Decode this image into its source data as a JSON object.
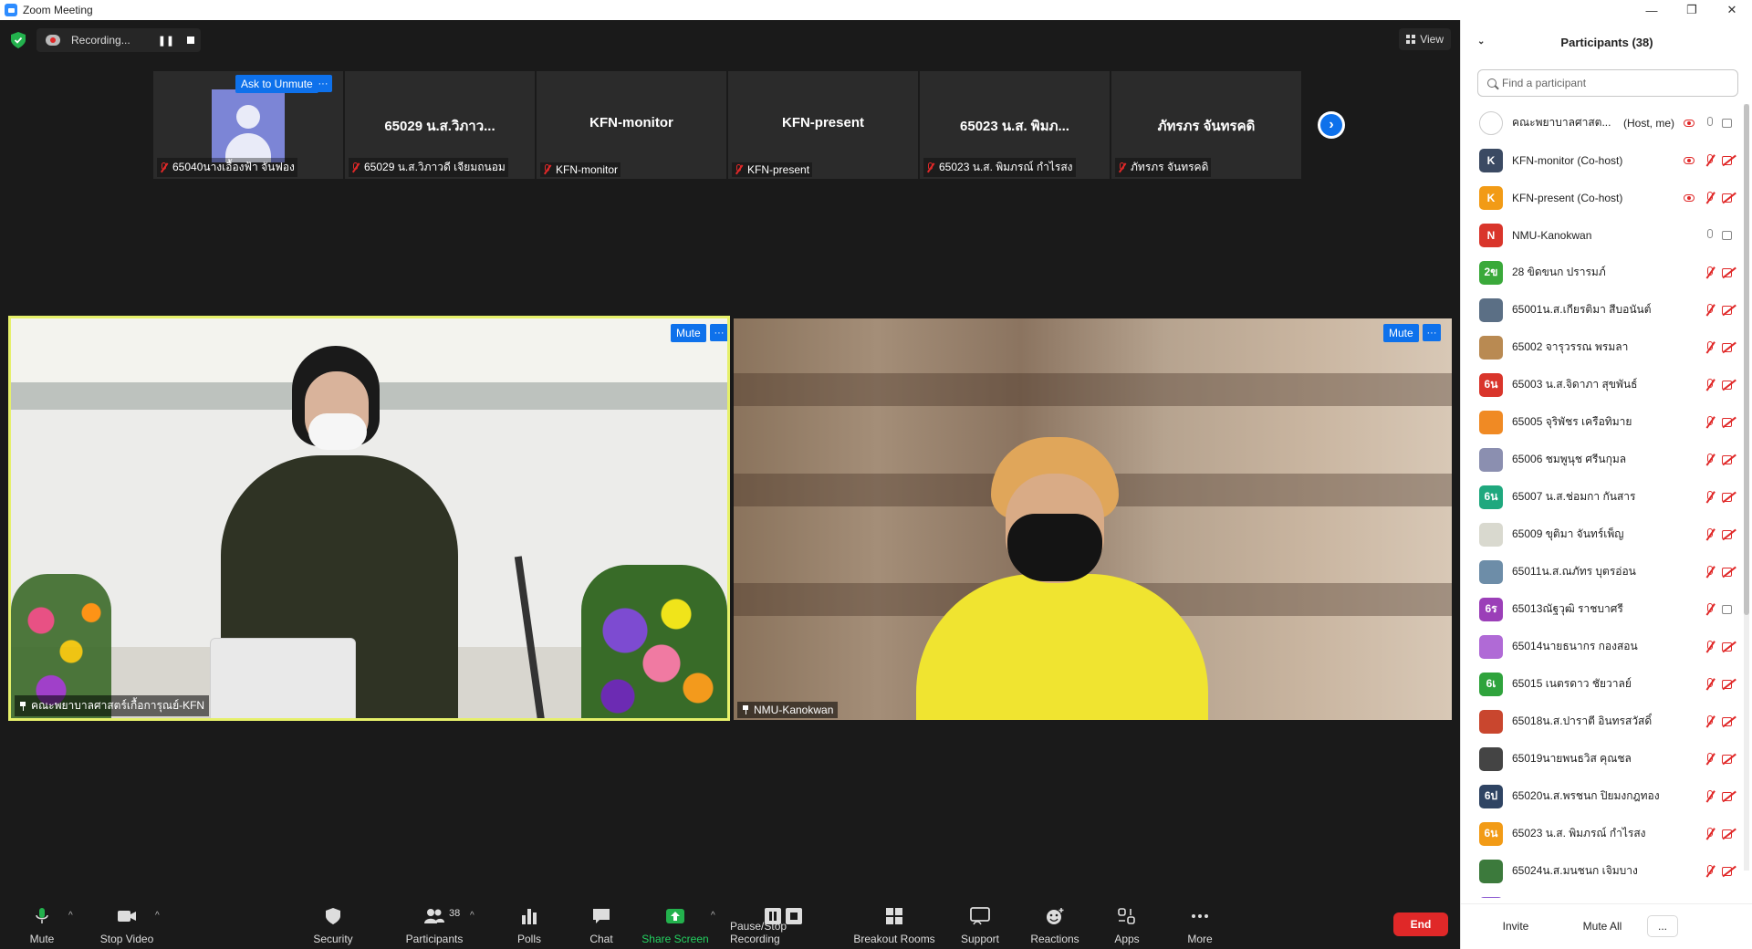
{
  "window": {
    "title": "Zoom Meeting",
    "controls": [
      "—",
      "❐",
      "✕"
    ]
  },
  "top": {
    "recording_label": "Recording...",
    "view_label": "View"
  },
  "gallery_strip": [
    {
      "display": "avatar",
      "caption": "65040นางเอื้องฟ้า จันฟอง",
      "ask_label": "Ask to Unmute"
    },
    {
      "display": "65029 น.ส.วิภาว...",
      "caption": "65029 น.ส.วิภาวดี เจียมถนอม"
    },
    {
      "display": "KFN-monitor",
      "caption": "KFN-monitor"
    },
    {
      "display": "KFN-present",
      "caption": "KFN-present"
    },
    {
      "display": "65023 น.ส. พิมภ...",
      "caption": "65023 น.ส. พิมภรณ์ กำไรสง"
    },
    {
      "display": "ภัทรภร จันทรคดิ",
      "caption": "ภัทรภร จันทรคดิ"
    }
  ],
  "videos": {
    "main_left": {
      "name": "คณะพยาบาลศาสตร์เกื้อการุณย์-KFN",
      "mute_label": "Mute"
    },
    "main_right": {
      "name": "NMU-Kanokwan",
      "mute_label": "Mute"
    }
  },
  "toolbar": {
    "mute": "Mute",
    "stop_video": "Stop Video",
    "security": "Security",
    "participants": "Participants",
    "participants_count": "38",
    "polls": "Polls",
    "chat": "Chat",
    "share_screen": "Share Screen",
    "pause_recording": "Pause/Stop Recording",
    "breakout": "Breakout Rooms",
    "support": "Support",
    "reactions": "Reactions",
    "apps": "Apps",
    "more": "More",
    "end": "End"
  },
  "panel": {
    "title": "Participants (38)",
    "search_placeholder": "Find a participant",
    "invite": "Invite",
    "mute_all": "Mute All",
    "more": "...",
    "participants": [
      {
        "avatar": "",
        "color": "#ffffff",
        "name": "คณะพยาบาลศาสต...",
        "suffix": "(Host, me)",
        "rec": true,
        "mic": "on",
        "cam": "on"
      },
      {
        "avatar": "K",
        "color": "#3b4a63",
        "name": "KFN-monitor (Co-host)",
        "suffix": "",
        "rec": true,
        "mic": "off",
        "cam": "off"
      },
      {
        "avatar": "K",
        "color": "#f29b16",
        "name": "KFN-present (Co-host)",
        "suffix": "",
        "rec": true,
        "mic": "off",
        "cam": "off"
      },
      {
        "avatar": "N",
        "color": "#d9352b",
        "name": "NMU-Kanokwan",
        "suffix": "",
        "rec": false,
        "mic": "on",
        "cam": "on"
      },
      {
        "avatar": "2ข",
        "color": "#3aa93a",
        "name": "28 ขิดขนก ปรารมภ์",
        "suffix": "",
        "rec": false,
        "mic": "off",
        "cam": "off"
      },
      {
        "avatar": "",
        "color": "#5b6f85",
        "name": "65001น.ส.เกียรติมา สีบอนันต์",
        "suffix": "",
        "rec": false,
        "mic": "off",
        "cam": "off"
      },
      {
        "avatar": "",
        "color": "#b98a52",
        "name": "65002 จารุวรรณ พรมลา",
        "suffix": "",
        "rec": false,
        "mic": "off",
        "cam": "off"
      },
      {
        "avatar": "6น",
        "color": "#d9352b",
        "name": "65003 น.ส.จิดาภา สุขพันธ์",
        "suffix": "",
        "rec": false,
        "mic": "off",
        "cam": "off"
      },
      {
        "avatar": "",
        "color": "#f08a24",
        "name": "65005 จุริพัชร เครือทิมาย",
        "suffix": "",
        "rec": false,
        "mic": "off",
        "cam": "off"
      },
      {
        "avatar": "",
        "color": "#8b8fb0",
        "name": "65006 ชมพูนุช ศรีนกุมล",
        "suffix": "",
        "rec": false,
        "mic": "off",
        "cam": "off"
      },
      {
        "avatar": "6น",
        "color": "#1fa87e",
        "name": "65007 น.ส.ช่อมกา กันสาร",
        "suffix": "",
        "rec": false,
        "mic": "off",
        "cam": "off"
      },
      {
        "avatar": "",
        "color": "#d9d9cf",
        "name": "65009 ขุติมา จันทร์เพ็ญ",
        "suffix": "",
        "rec": false,
        "mic": "off",
        "cam": "off"
      },
      {
        "avatar": "",
        "color": "#6d8da8",
        "name": "65011น.ส.ณภัทร บุตรอ่อน",
        "suffix": "",
        "rec": false,
        "mic": "off",
        "cam": "off"
      },
      {
        "avatar": "6ร",
        "color": "#9b3fb8",
        "name": "65013ณัฐวุฒิ    ราชบาศรี",
        "suffix": "",
        "rec": false,
        "mic": "off",
        "cam": "on"
      },
      {
        "avatar": "",
        "color": "#b06ad6",
        "name": "65014นายธนากร กองสอน",
        "suffix": "",
        "rec": false,
        "mic": "off",
        "cam": "off"
      },
      {
        "avatar": "6เ",
        "color": "#2fa33c",
        "name": "65015 เนตรดาว ชัยวาลย์",
        "suffix": "",
        "rec": false,
        "mic": "off",
        "cam": "off"
      },
      {
        "avatar": "",
        "color": "#c9462e",
        "name": "65018น.ส.ปาราตี อินทรสวัสดิ์",
        "suffix": "",
        "rec": false,
        "mic": "off",
        "cam": "off"
      },
      {
        "avatar": "",
        "color": "#444444",
        "name": "65019นายพนธวิส คุณชล",
        "suffix": "",
        "rec": false,
        "mic": "off",
        "cam": "off"
      },
      {
        "avatar": "6ป",
        "color": "#2f4463",
        "name": "65020น.ส.พรชนก ปิยมงกฎทอง",
        "suffix": "",
        "rec": false,
        "mic": "off",
        "cam": "off"
      },
      {
        "avatar": "6น",
        "color": "#f29b16",
        "name": "65023 น.ส. พิมภรณ์ กำไรสง",
        "suffix": "",
        "rec": false,
        "mic": "off",
        "cam": "off"
      },
      {
        "avatar": "",
        "color": "#3c7a3c",
        "name": "65024น.ส.มนชนก เจิมบาง",
        "suffix": "",
        "rec": false,
        "mic": "off",
        "cam": "off"
      },
      {
        "avatar": "",
        "color": "#8d5bd1",
        "name": "",
        "suffix": "",
        "rec": false,
        "mic": "off",
        "cam": "off"
      }
    ]
  }
}
